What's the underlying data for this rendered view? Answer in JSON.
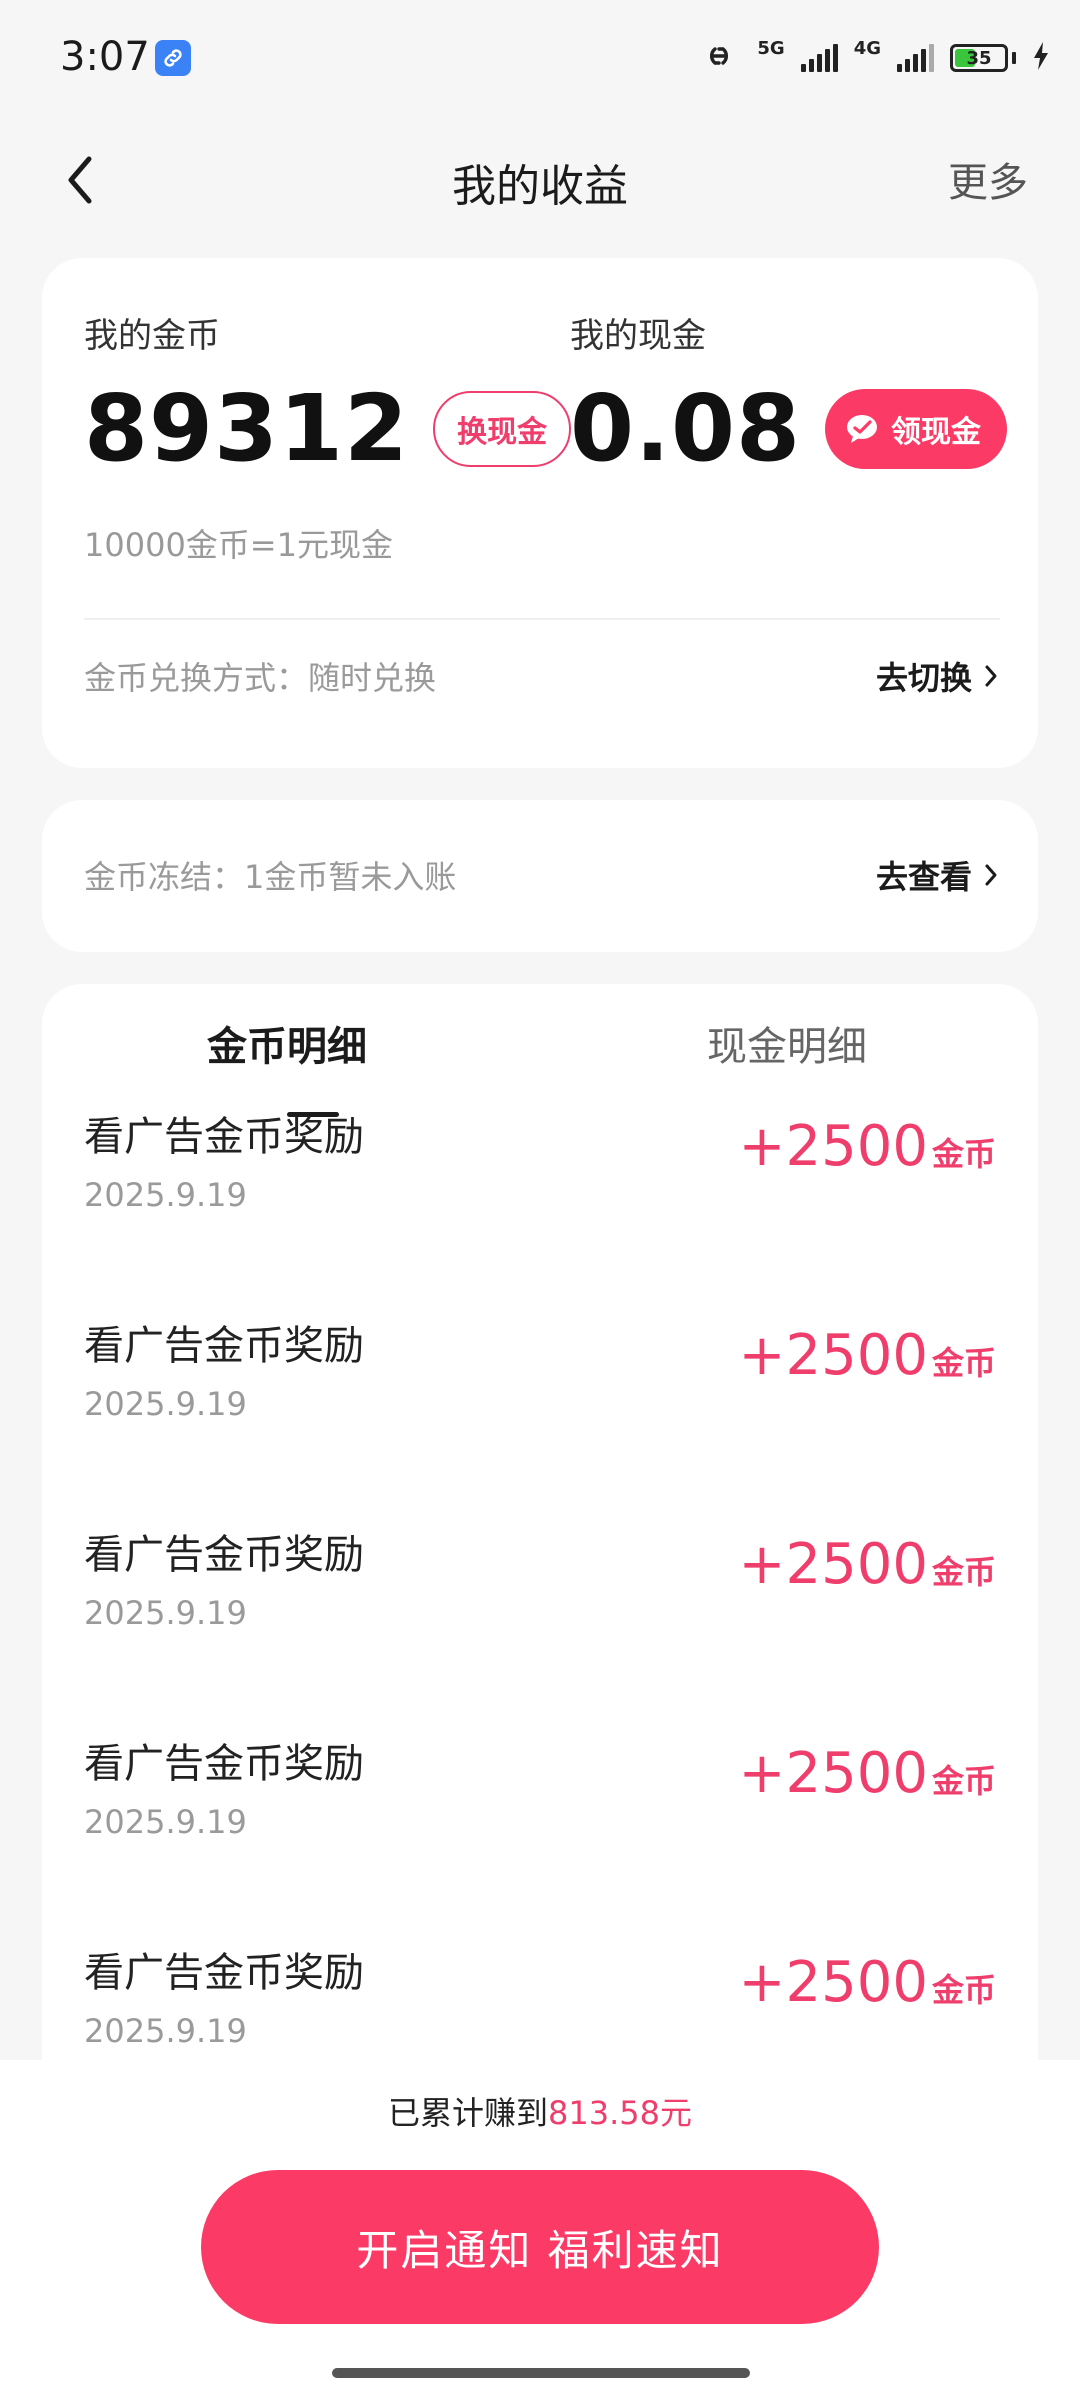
{
  "status": {
    "time": "3:07",
    "network_1": "5G",
    "network_2": "4G",
    "battery": "35"
  },
  "nav": {
    "title": "我的收益",
    "more": "更多"
  },
  "balance": {
    "coins_label": "我的金币",
    "coins_value": "89312",
    "exchange_button": "换现金",
    "cash_label": "我的现金",
    "cash_value": "0.08",
    "claim_button": "领现金",
    "rate": "10000金币=1元现金",
    "exchange_method": "金币兑换方式：随时兑换",
    "switch_action": "去切换"
  },
  "frozen": {
    "text": "金币冻结：1金币暂未入账",
    "view_action": "去查看"
  },
  "tabs": {
    "coin_detail": "金币明细",
    "cash_detail": "现金明细"
  },
  "records": [
    {
      "title": "看广告金币奖励",
      "date": "2025.9.19",
      "amount": "+2500",
      "unit": "金币"
    },
    {
      "title": "看广告金币奖励",
      "date": "2025.9.19",
      "amount": "+2500",
      "unit": "金币"
    },
    {
      "title": "看广告金币奖励",
      "date": "2025.9.19",
      "amount": "+2500",
      "unit": "金币"
    },
    {
      "title": "看广告金币奖励",
      "date": "2025.9.19",
      "amount": "+2500",
      "unit": "金币"
    },
    {
      "title": "看广告金币奖励",
      "date": "2025.9.19",
      "amount": "+2500",
      "unit": "金币"
    }
  ],
  "footer": {
    "earned_prefix": "已累计赚到",
    "earned_amount": "813.58元",
    "notify_button": "开启通知 福利速知"
  },
  "colors": {
    "accent": "#fb3a66",
    "accent_text": "#ef3d6c",
    "background": "#f6f6f6"
  }
}
